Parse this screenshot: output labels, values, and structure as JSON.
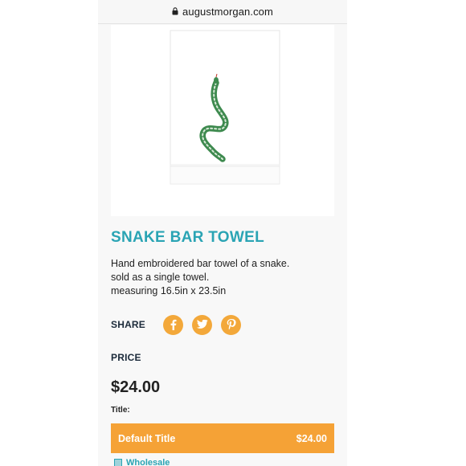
{
  "browser": {
    "url": "augustmorgan.com"
  },
  "product": {
    "image_alt": "snake-embroidered-towel",
    "title": "SNAKE BAR TOWEL",
    "description": [
      "Hand embroidered bar towel of a snake.",
      "sold as a single towel.",
      "measuring 16.5in x 23.5in"
    ]
  },
  "share": {
    "label": "SHARE",
    "networks": [
      "facebook",
      "twitter",
      "pinterest"
    ]
  },
  "pricing": {
    "label": "PRICE",
    "price": "$24.00",
    "title_label": "Title:",
    "variant_name": "Default Title",
    "variant_price": "$24.00"
  },
  "wholesale": {
    "label": "Wholesale"
  },
  "colors": {
    "accent_teal": "#2aa4b4",
    "accent_orange": "#f5a236",
    "snake_green": "#3e8a4f"
  }
}
